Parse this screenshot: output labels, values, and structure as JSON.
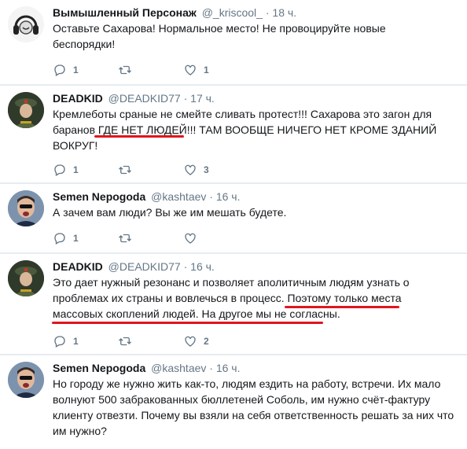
{
  "colors": {
    "accent_underline": "#e0161e",
    "secondary_text": "#657786",
    "divider": "#e6ecf0"
  },
  "tweets": [
    {
      "name": "Вымышленный Персонаж",
      "handle": "@_kriscool_",
      "dot": "·",
      "time": "18 ч.",
      "avatar": "headphones-avatar",
      "lines": [
        "Оставьте Сахарова! Нормальное место! Не провоцируйте новые",
        "беспорядки!"
      ],
      "replies": "1",
      "retweets": "",
      "likes": "1"
    },
    {
      "name": "DEADKID",
      "handle": "@DEADKID77",
      "dot": "·",
      "time": "17 ч.",
      "avatar": "uniform-avatar",
      "line1": "Кремлеботы сраные не смейте сливать протест!!! Сахарова это загон для",
      "line2_a": "баранов ",
      "line2_b": "ГДЕ НЕТ ЛЮДЕЙ!!!",
      "line2_c": " ТАМ ВООБЩЕ НИЧЕГО НЕТ КРОМЕ ЗДАНИЙ",
      "line3": "ВОКРУГ!",
      "replies": "1",
      "retweets": "",
      "likes": "3"
    },
    {
      "name": "Semen Nepogoda",
      "handle": "@kashtaev",
      "dot": "·",
      "time": "16 ч.",
      "avatar": "selfie-avatar",
      "lines": [
        "А зачем вам люди? Вы же им мешать будете."
      ],
      "replies": "1",
      "retweets": "",
      "likes": ""
    },
    {
      "name": "DEADKID",
      "handle": "@DEADKID77",
      "dot": "·",
      "time": "16 ч.",
      "avatar": "uniform-avatar",
      "lines": [
        "Это дает нужный резонанс и позволяет аполитичным людям узнать о",
        "проблемах их страны и вовлечься в процесс. Поэтому только места",
        "массовых скоплений людей. На другое мы не согласны."
      ],
      "replies": "1",
      "retweets": "",
      "likes": "2"
    },
    {
      "name": "Semen Nepogoda",
      "handle": "@kashtaev",
      "dot": "·",
      "time": "16 ч.",
      "avatar": "selfie-avatar",
      "lines": [
        "Но городу же нужно жить как-то, людям ездить на работу, встречи. Их мало",
        "волнуют 500 забракованных бюллетеней Соболь, им нужно счёт-фактуру",
        "клиенту отвезти. Почему вы взяли на себя ответственность решать за них что",
        "им нужно?"
      ],
      "replies": "",
      "retweets": "",
      "likes": ""
    }
  ]
}
